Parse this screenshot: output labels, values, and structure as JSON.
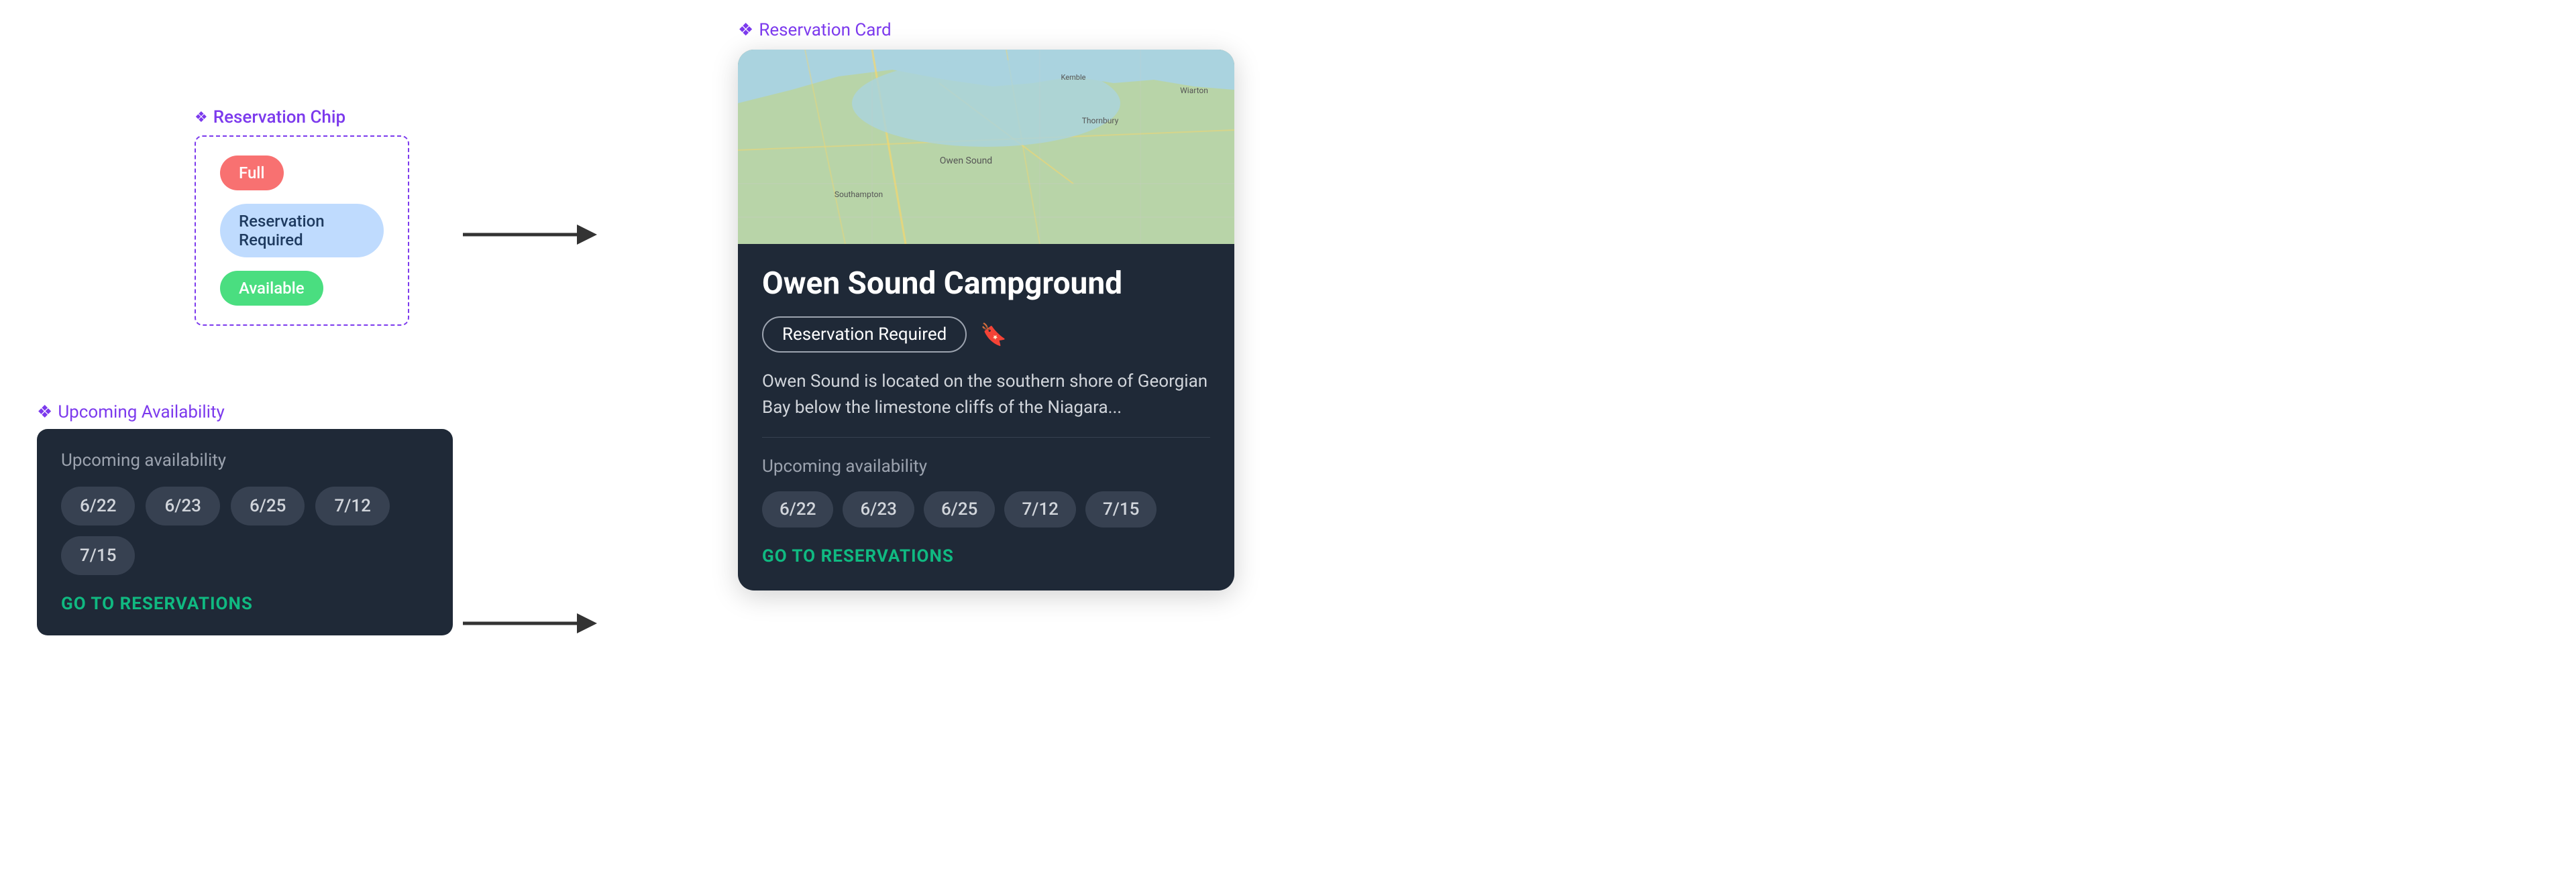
{
  "chipSection": {
    "label": "Reservation Chip",
    "diamond": "❖",
    "chips": [
      {
        "text": "Full",
        "type": "full"
      },
      {
        "text": "Reservation Required",
        "type": "reservation"
      },
      {
        "text": "Available",
        "type": "available"
      }
    ]
  },
  "upcomingSection": {
    "label": "Upcoming Availability",
    "diamond": "❖",
    "title": "Upcoming availability",
    "dates": [
      "6/22",
      "6/23",
      "6/25",
      "7/12",
      "7/15"
    ],
    "goButton": "GO TO RESERVATIONS"
  },
  "cardSection": {
    "label": "Reservation Card",
    "diamond": "❖",
    "campgroundName": "Owen Sound Campground",
    "reservationChip": "Reservation Required",
    "description": "Owen Sound is located on the southern shore of Georgian Bay below the limestone cliffs of the Niagara...",
    "upcomingTitle": "Upcoming availability",
    "dates": [
      "6/22",
      "6/23",
      "6/25",
      "7/12",
      "7/15"
    ],
    "goButton": "GO TO RESERVATIONS"
  },
  "arrows": [
    {
      "id": "arrow-chip-to-card",
      "label": "→"
    },
    {
      "id": "arrow-upcoming-to-card",
      "label": "→"
    }
  ]
}
